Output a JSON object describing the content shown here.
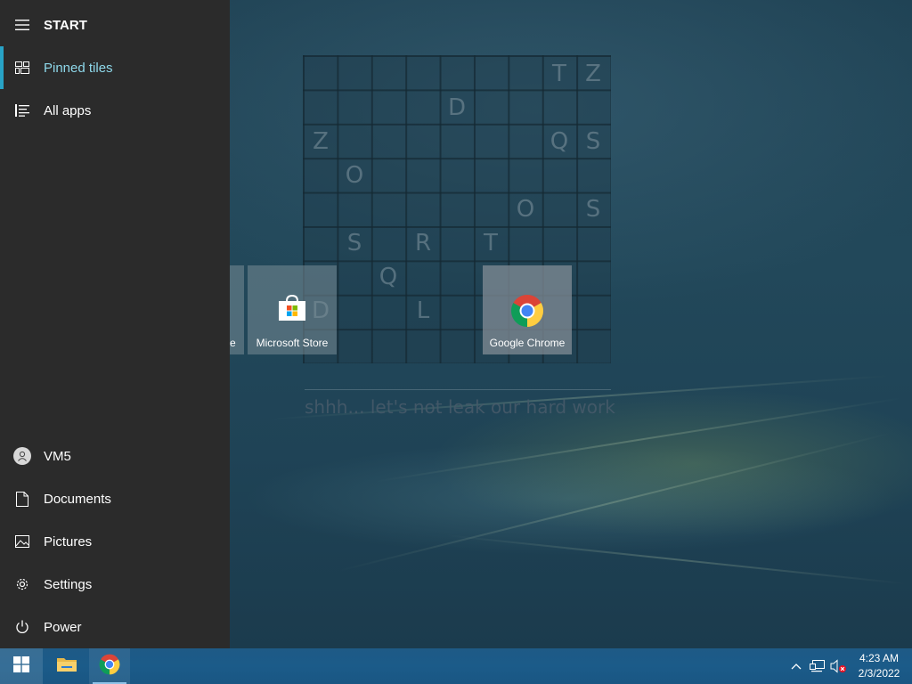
{
  "start_panel": {
    "header_label": "START",
    "items": [
      {
        "label": "Pinned tiles",
        "icon": "tiles-icon"
      },
      {
        "label": "All apps",
        "icon": "list-icon"
      }
    ],
    "bottom_items": [
      {
        "label": "VM5",
        "icon": "user-avatar-icon"
      },
      {
        "label": "Documents",
        "icon": "document-icon"
      },
      {
        "label": "Pictures",
        "icon": "picture-icon"
      },
      {
        "label": "Settings",
        "icon": "gear-icon"
      },
      {
        "label": "Power",
        "icon": "power-icon"
      }
    ],
    "accent_color": "#28a3c6"
  },
  "tiles": {
    "partial_label": "e",
    "store_label": "Microsoft Store",
    "chrome_label": "Google Chrome"
  },
  "wallpaper": {
    "letters": [
      "T",
      "Z",
      "D",
      "Z",
      "Q",
      "S",
      "O",
      "O",
      "S",
      "S",
      "R",
      "T",
      "Q",
      "D",
      "L"
    ],
    "caption": "shhh... let's not leak our hard work"
  },
  "taskbar": {
    "apps": [
      "file-explorer-icon",
      "chrome-icon"
    ],
    "tray_icons": [
      "chevron-up-icon",
      "network-icon",
      "volume-muted-icon"
    ],
    "clock_time": "4:23 AM",
    "clock_date": "2/3/2022"
  }
}
